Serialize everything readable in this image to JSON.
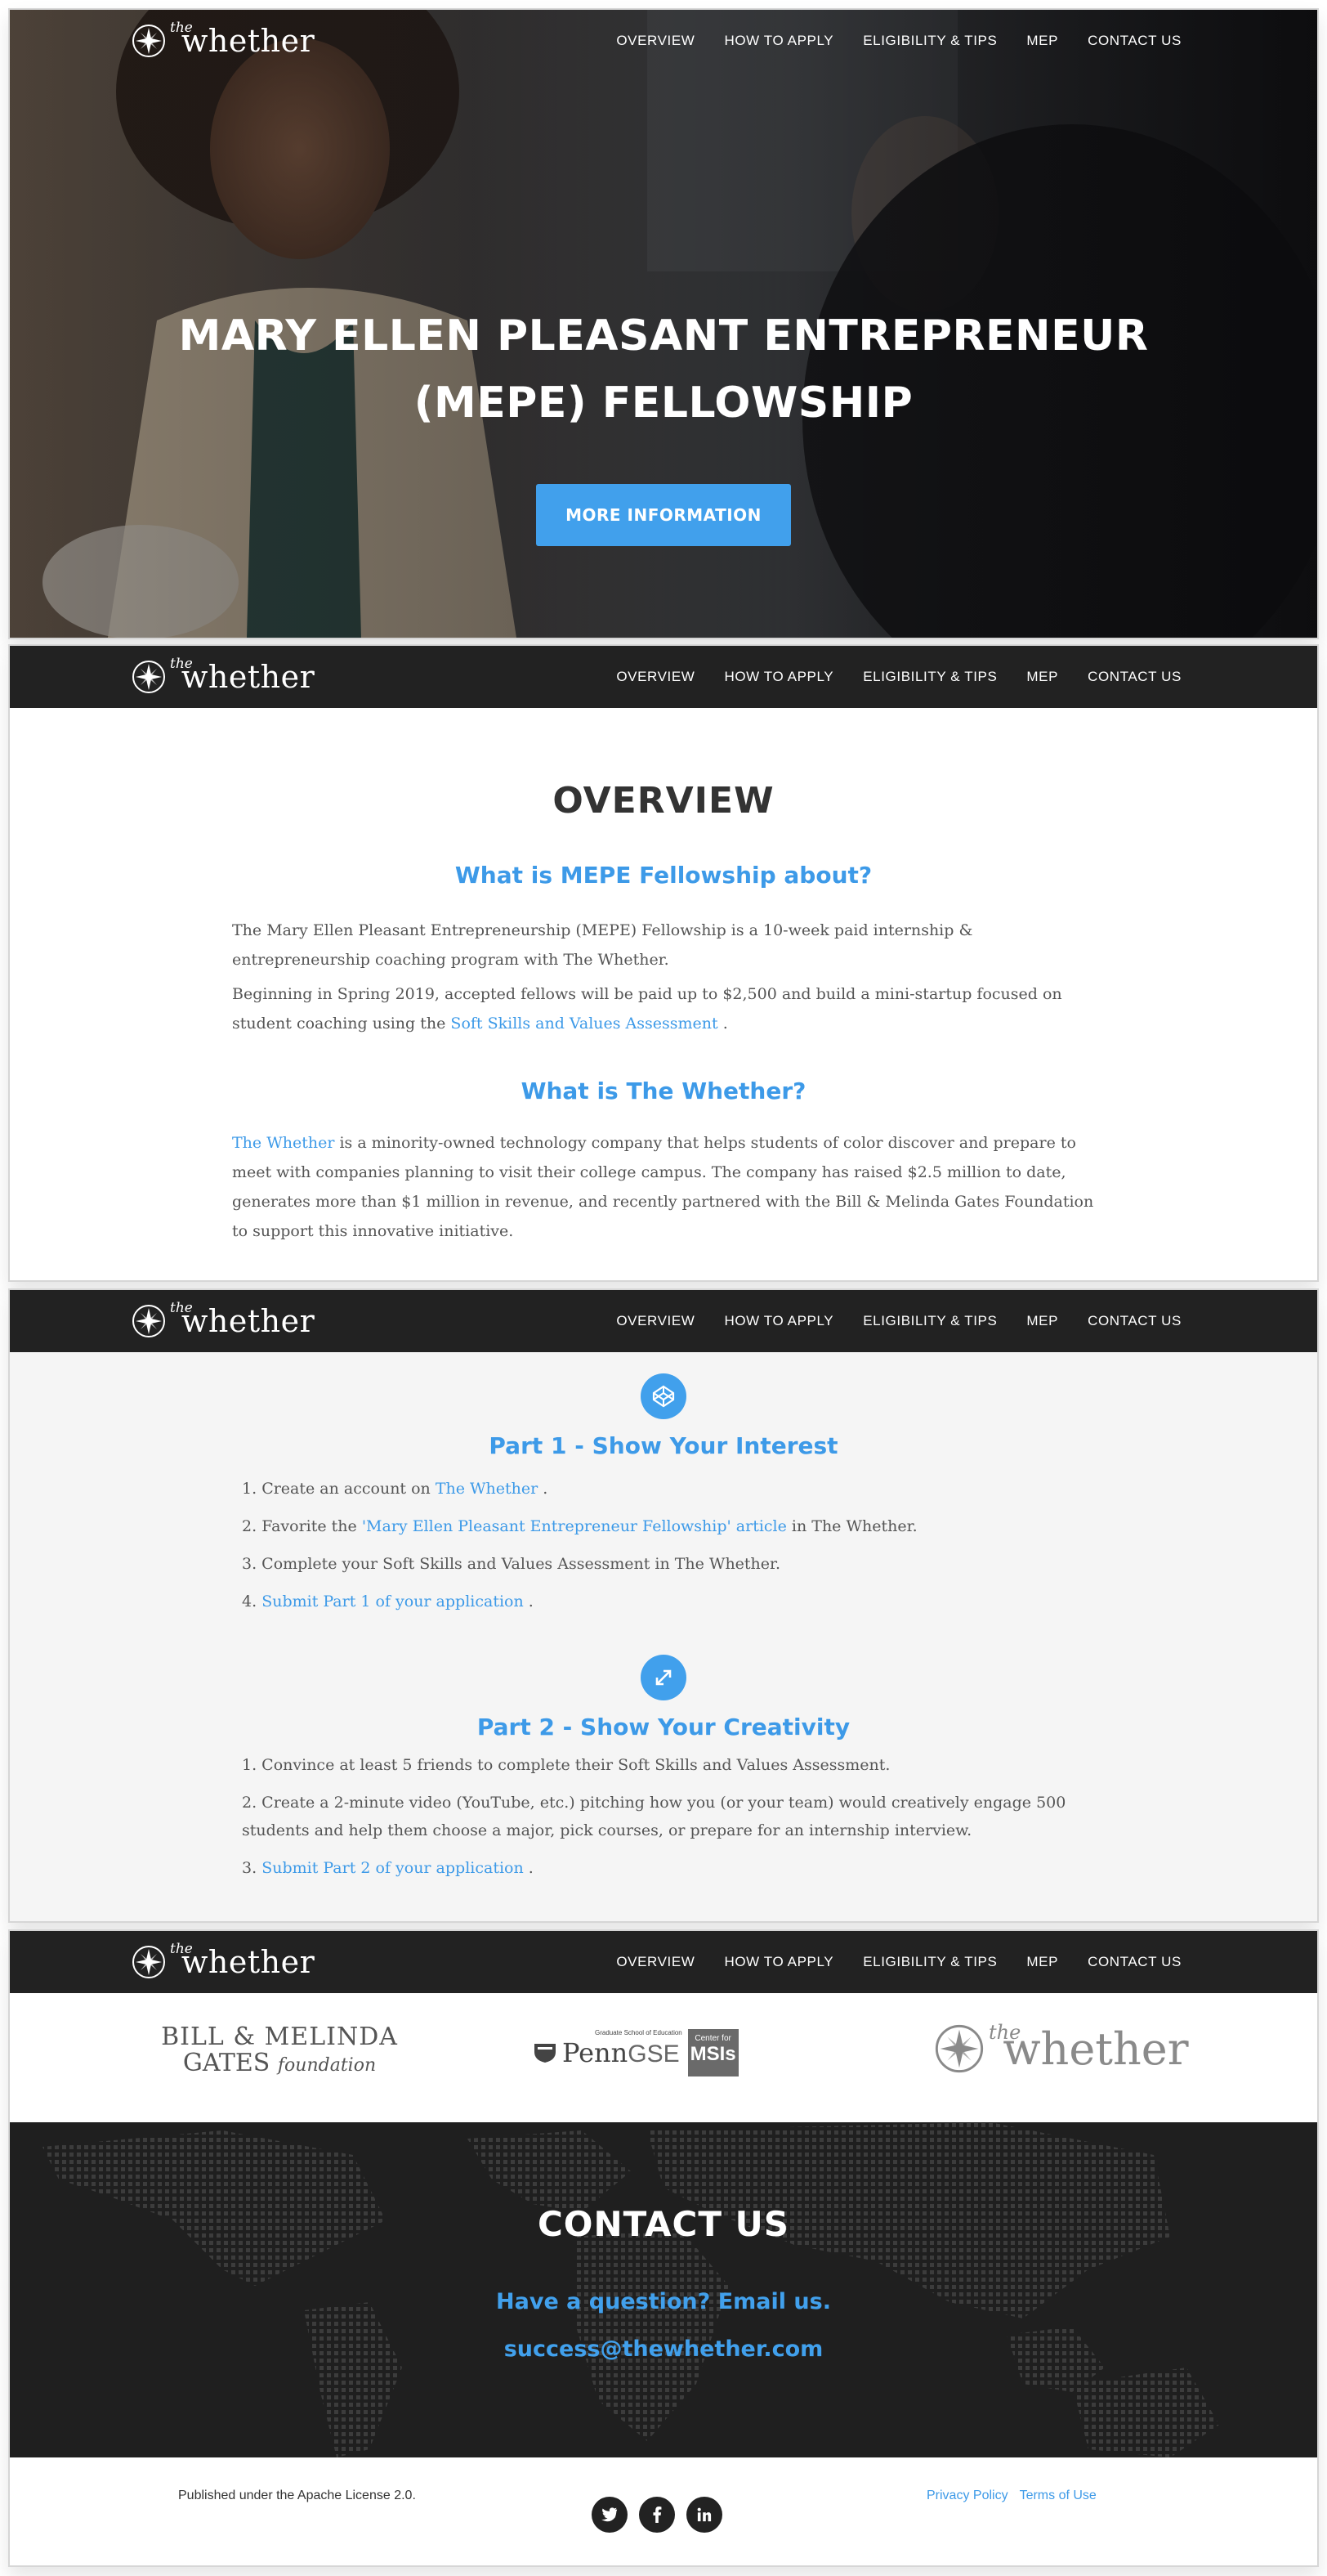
{
  "nav": {
    "logo_small": "the",
    "logo_main": "whether",
    "items": [
      "OVERVIEW",
      "HOW TO APPLY",
      "ELIGIBILITY & TIPS",
      "MEP",
      "CONTACT US"
    ]
  },
  "hero": {
    "title_line1": "MARY ELLEN PLEASANT ENTREPRENEUR",
    "title_line2": "(MEPE) FELLOWSHIP",
    "button": "MORE INFORMATION"
  },
  "overview": {
    "title": "OVERVIEW",
    "q1": "What is MEPE Fellowship about?",
    "p1": "The Mary Ellen Pleasant Entrepreneurship (MEPE) Fellowship is a 10-week paid internship & entrepreneurship coaching program with The Whether.",
    "p2_before": "Beginning in Spring 2019, accepted fellows will be paid up to $2,500 and build a mini-startup focused on student coaching using the",
    "p2_link": "Soft Skills and Values Assessment",
    "p2_after": ".",
    "q2": "What is The Whether?",
    "p3_link": "The Whether",
    "p3_rest": "is a minority-owned technology company that helps students of color discover and prepare to meet with companies planning to visit their college campus. The company has raised $2.5 million to date, generates more than $1 million in revenue, and recently partnered with the Bill & Melinda Gates Foundation to support this innovative initiative."
  },
  "apply": {
    "part1_title": "Part 1 - Show Your Interest",
    "part1": {
      "s1_num": "1.",
      "s1_text": "Create an account on",
      "s1_link": "The Whether",
      "s1_end": ".",
      "s2_num": "2.",
      "s2_text": "Favorite the",
      "s2_link": "'Mary Ellen Pleasant Entrepreneur Fellowship' article",
      "s2_end": "in The Whether.",
      "s3": "3. Complete your Soft Skills and Values Assessment in The Whether.",
      "s4_num": "4.",
      "s4_link": "Submit Part 1 of your application",
      "s4_end": "."
    },
    "part2_title": "Part 2 - Show Your Creativity",
    "part2": {
      "s1": "1. Convince at least 5 friends to complete their Soft Skills and Values Assessment.",
      "s2": "2. Create a 2-minute video (YouTube, etc.) pitching how you (or your team) would creatively engage 500 students and help them choose a major, pick courses, or prepare for an internship interview.",
      "s3_num": "3.",
      "s3_link": "Submit Part 2 of your application",
      "s3_end": "."
    }
  },
  "partners": {
    "gates_line1": "BILL & MELINDA",
    "gates_line2": "GATES",
    "gates_line3": "foundation",
    "penn_small": "Graduate School of Education",
    "penn_main": "Penn",
    "penn_gse": "GSE",
    "msi_small": "Center for",
    "msi_main": "MSIs",
    "whether_small": "the",
    "whether_main": "whether"
  },
  "contact": {
    "title": "CONTACT US",
    "question": "Have a question? Email us.",
    "email": "success@thewhether.com"
  },
  "footer": {
    "license": "Published under the Apache License 2.0.",
    "privacy": "Privacy Policy",
    "terms": "Terms of Use",
    "social": [
      "twitter-icon",
      "facebook-icon",
      "linkedin-icon"
    ]
  },
  "colors": {
    "accent": "#41a0ec",
    "dark": "#222222",
    "gray_bg": "#f5f5f5"
  }
}
